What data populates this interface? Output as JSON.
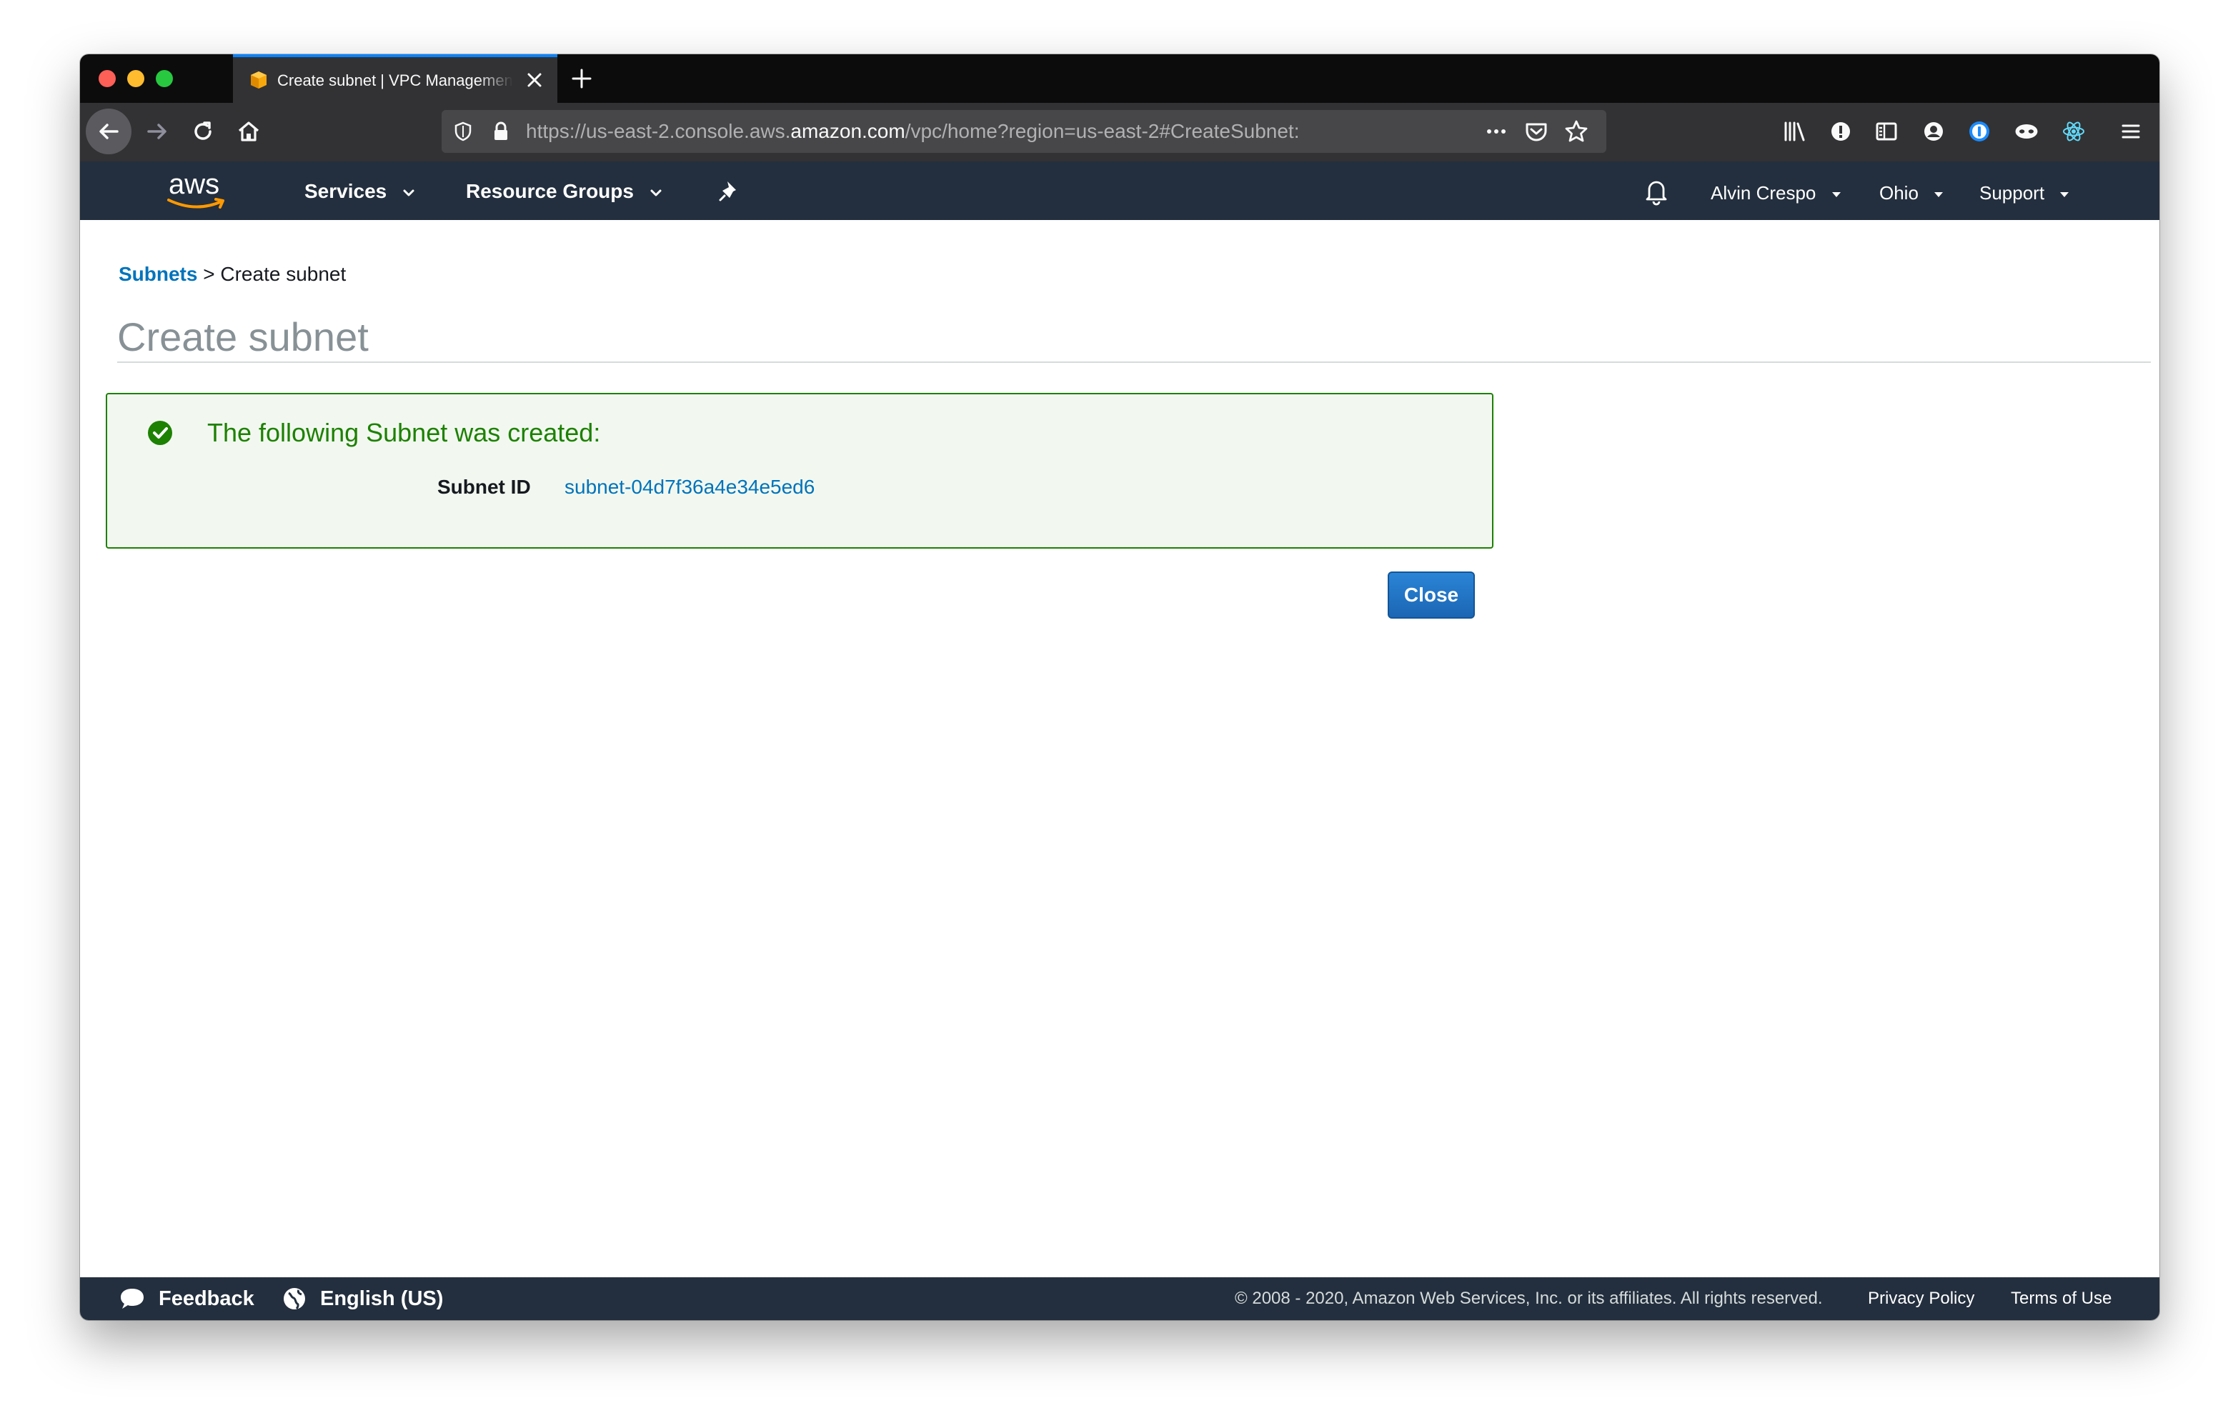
{
  "browser": {
    "tab_title": "Create subnet | VPC Management Console",
    "url_prefix": "https://us-east-2.console.aws.",
    "url_host": "amazon.com",
    "url_suffix": "/vpc/home?region=us-east-2#CreateSubnet:"
  },
  "nav": {
    "logo": "aws",
    "services": "Services",
    "resource_groups": "Resource Groups",
    "user": "Alvin Crespo",
    "region": "Ohio",
    "support": "Support"
  },
  "breadcrumb": {
    "parent": "Subnets",
    "separator": ">",
    "current": "Create subnet"
  },
  "page": {
    "title": "Create subnet"
  },
  "success": {
    "message": "The following Subnet was created:",
    "label": "Subnet ID",
    "subnet_id": "subnet-04d7f36a4e34e5ed6"
  },
  "actions": {
    "close": "Close"
  },
  "footer": {
    "feedback": "Feedback",
    "language": "English (US)",
    "copyright": "© 2008 - 2020, Amazon Web Services, Inc. or its affiliates. All rights reserved.",
    "privacy": "Privacy Policy",
    "terms": "Terms of Use"
  },
  "colors": {
    "nav_bg": "#232f3e",
    "success_green": "#1d8102",
    "link_blue": "#0073bb",
    "button_blue": "#1e73c8",
    "aws_orange": "#ff9900"
  }
}
